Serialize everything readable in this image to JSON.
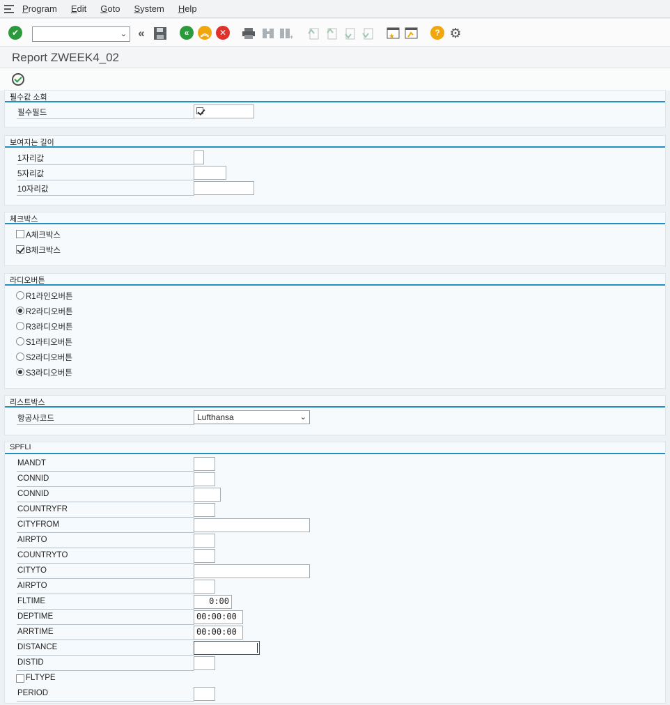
{
  "menu": [
    "Program",
    "Edit",
    "Goto",
    "System",
    "Help"
  ],
  "title": "Report ZWEEK4_02",
  "sections": {
    "required": {
      "title": "필수값 소회",
      "field_label": "필수필드"
    },
    "lengths": {
      "title": "보여지는 길이",
      "labels": [
        "1자리값",
        "5자리값",
        "10자리값"
      ]
    },
    "checkboxes": {
      "title": "체크박스",
      "a_label": "A체크박스",
      "b_label": "B체크박스"
    },
    "radios": {
      "title": "라디오버튼",
      "labels": [
        "R1라인오버튼",
        "R2라디오버튼",
        "R3라디오버튼",
        "S1라티오버튼",
        "S2라디오버튼",
        "S3라디오버튼"
      ],
      "selected": [
        "R2라디오버튼",
        "S3라디오버튼"
      ]
    },
    "listbox": {
      "title": "리스트박스",
      "label": "항공사코드",
      "value": "Lufthansa"
    },
    "spfli": {
      "title": "SPFLI",
      "fields": [
        "MANDT",
        "CONNID",
        "CONNID",
        "COUNTRYFR",
        "CITYFROM",
        "AIRPTO",
        "COUNTRYTO",
        "CITYTO",
        "AIRPTO",
        "FLTIME",
        "DEPTIME",
        "ARRTIME",
        "DISTANCE",
        "DISTID",
        "FLTYPE",
        "PERIOD"
      ],
      "fltime_value": "0:00",
      "deptime_value": "00:00:00",
      "arrtime_value": "00:00:00"
    }
  },
  "icons": {
    "enter": "check-icon",
    "back": "back-icon",
    "exit": "exit-icon",
    "cancel": "cancel-icon",
    "save": "save-icon",
    "print": "print-icon",
    "find": "find-icon",
    "help": "help-icon",
    "settings": "gear-icon"
  },
  "colors": {
    "accent_line": "#1f8fc4",
    "green": "#2c9a3c",
    "orange": "#f1a70b",
    "red": "#e0322c"
  }
}
